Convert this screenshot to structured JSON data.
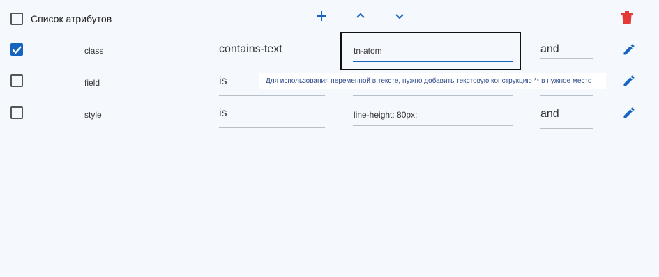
{
  "header": {
    "label": "Список атрибутов",
    "add_icon": "plus-icon",
    "up_icon": "chevron-up-icon",
    "down_icon": "chevron-down-icon",
    "delete_icon": "trash-icon"
  },
  "rows": [
    {
      "checked": true,
      "attribute": "class",
      "operator": "contains-text",
      "value": "tn-atom",
      "logic": "and",
      "edit_icon": "pencil-icon"
    },
    {
      "checked": false,
      "attribute": "field",
      "operator": "is",
      "value": "",
      "logic": "",
      "edit_icon": "pencil-icon"
    },
    {
      "checked": false,
      "attribute": "style",
      "operator": "is",
      "value": "line-height: 80px;",
      "logic": "and",
      "edit_icon": "pencil-icon"
    }
  ],
  "tooltip": {
    "text": "Для использования переменной в тексте, нужно добавить текстовую конструкцию ** в нужное место"
  },
  "colors": {
    "accent": "#1565c0",
    "delete": "#e53935",
    "background": "#f5f9fe"
  }
}
